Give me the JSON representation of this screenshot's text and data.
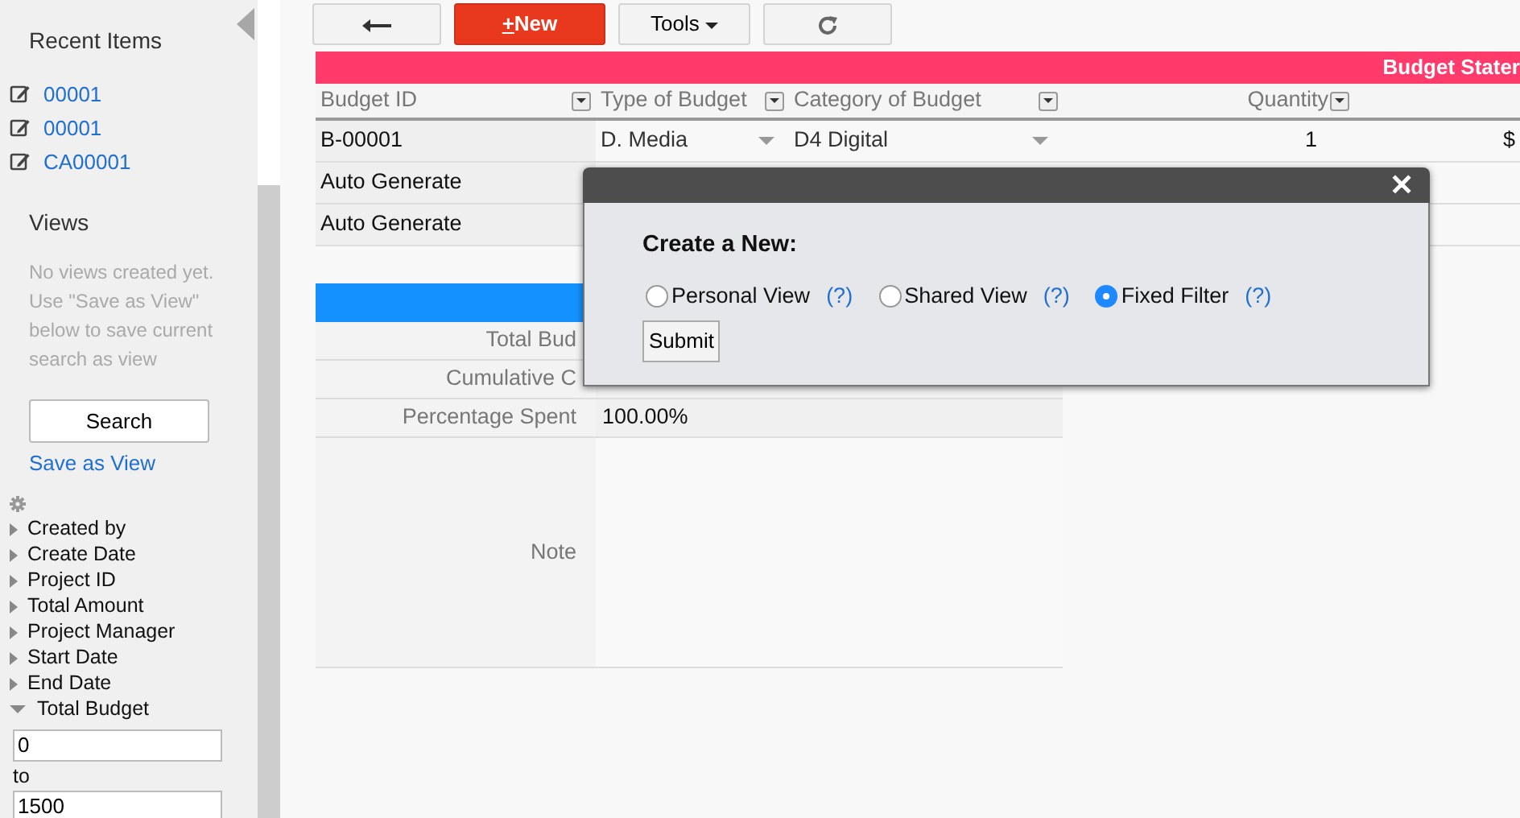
{
  "sidebar": {
    "recent_title": "Recent Items",
    "recent_items": [
      {
        "label": "00001"
      },
      {
        "label": "00001"
      },
      {
        "label": "CA00001"
      }
    ],
    "views_title": "Views",
    "views_note": "No views created yet. Use \"Save as View\" below to save current search as view",
    "search_button": "Search",
    "save_view_link": "Save as View",
    "filters": [
      {
        "label": "Created by",
        "expanded": false
      },
      {
        "label": "Create Date",
        "expanded": false
      },
      {
        "label": "Project ID",
        "expanded": false
      },
      {
        "label": "Total Amount",
        "expanded": false
      },
      {
        "label": "Project Manager",
        "expanded": false
      },
      {
        "label": "Start Date",
        "expanded": false
      },
      {
        "label": "End Date",
        "expanded": false
      },
      {
        "label": "Total Budget",
        "expanded": true,
        "from": "0",
        "to_label": "to",
        "to": "1500"
      }
    ]
  },
  "toolbar": {
    "new_button": "+New",
    "tools_button": "Tools"
  },
  "banner": "Budget Stater",
  "table": {
    "columns": [
      {
        "label": "Budget ID",
        "kind": "text"
      },
      {
        "label": "Type of Budget",
        "kind": "select"
      },
      {
        "label": "Category of Budget",
        "kind": "select"
      },
      {
        "label": "Quantity",
        "kind": "number"
      },
      {
        "kind": "text"
      }
    ],
    "rows": [
      [
        "B-00001",
        "D. Media",
        "D4 Digital",
        "1",
        "$"
      ],
      [
        "Auto Generate"
      ],
      [
        "Auto Generate"
      ]
    ]
  },
  "form": {
    "rows": [
      {
        "label": "Total Bud"
      },
      {
        "label": "Cumulative C"
      },
      {
        "label": "Percentage Spent",
        "value": "100.00%"
      },
      {
        "label": "Note",
        "kind": "note"
      }
    ]
  },
  "dialog": {
    "close": "✕",
    "heading": "Create a New:",
    "options": [
      {
        "label": "Personal View",
        "help": "(?)",
        "selected": false
      },
      {
        "label": "Shared View",
        "help": "(?)",
        "selected": false
      },
      {
        "label": "Fixed Filter",
        "help": "(?)",
        "selected": true
      }
    ],
    "submit": "Submit"
  }
}
